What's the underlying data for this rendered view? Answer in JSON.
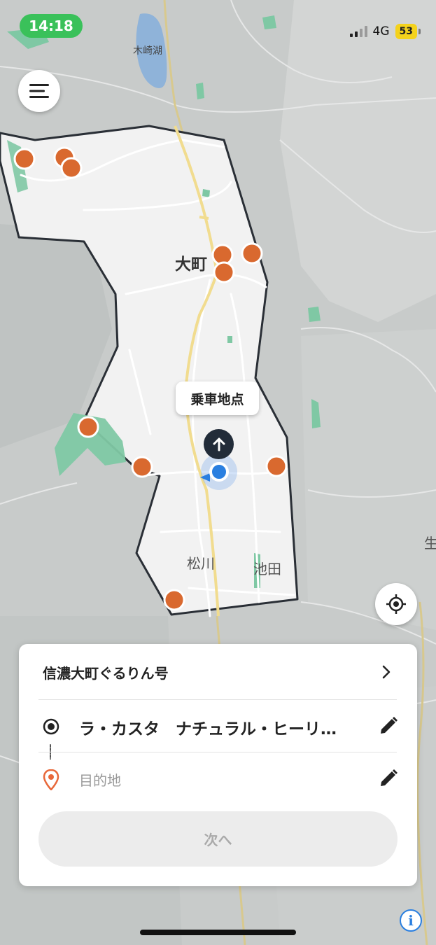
{
  "status_bar": {
    "time": "14:18",
    "network": "4G",
    "battery": "53",
    "time_pill_color": "#3ac15a",
    "battery_color": "#f4d21c"
  },
  "map": {
    "labels": {
      "lake": "木崎湖",
      "town_main": "大町",
      "area_matsukawa": "松川",
      "area_ikeda": "池田",
      "edge_partial": "生"
    },
    "service_area_fill": "#f2f2f2",
    "stop_color": "#d9692f",
    "pickup_label": "乗車地点"
  },
  "menu_button": {
    "icon": "hamburger-menu-icon"
  },
  "locate_button": {
    "icon": "crosshair-locate-icon"
  },
  "card": {
    "route_name": "信濃大町ぐるりん号",
    "origin": "ラ・カスタ　ナチュラル・ヒーリ…",
    "destination_placeholder": "目的地",
    "next_label": "次へ"
  },
  "info_icon_label": "i",
  "colors": {
    "accent_blue": "#2a7fe0",
    "destination_pin": "#e8683a"
  }
}
